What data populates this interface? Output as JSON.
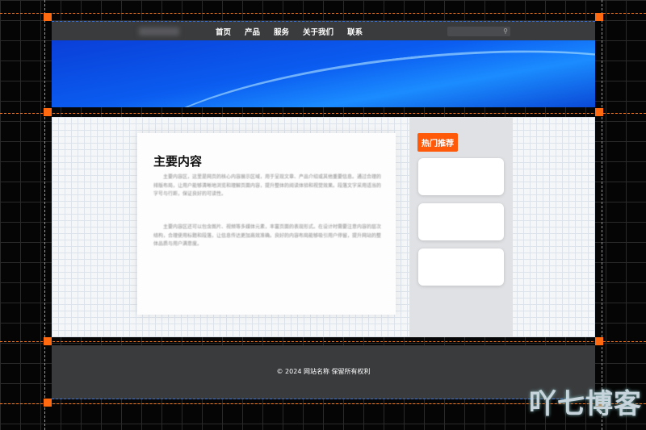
{
  "header": {
    "nav": [
      "首页",
      "产品",
      "服务",
      "关于我们",
      "联系"
    ],
    "search_icon": "search-icon"
  },
  "main": {
    "title": "主要内容",
    "paragraphs": [
      "主要内容区，这里是网页的核心内容展示区域，用于呈现文章、产品介绍或其他重要信息。通过合理的排版布局，让用户能够清晰地浏览和理解页面内容，提升整体的阅读体验和视觉效果。段落文字采用适当的字号与行距，保证良好的可读性。",
      "主要内容区还可以包含图片、视频等多媒体元素，丰富页面的表现形式。在设计时需要注意内容的层次结构，合理使用标题和段落，让信息传达更加高效准确。良好的内容布局能够吸引用户停留，提升网站的整体品质与用户满意度。"
    ]
  },
  "sidebar": {
    "badge": "热门推荐"
  },
  "footer": {
    "copyright": "© 2024 网站名称 保留所有权利"
  },
  "watermark": "吖七博客"
}
